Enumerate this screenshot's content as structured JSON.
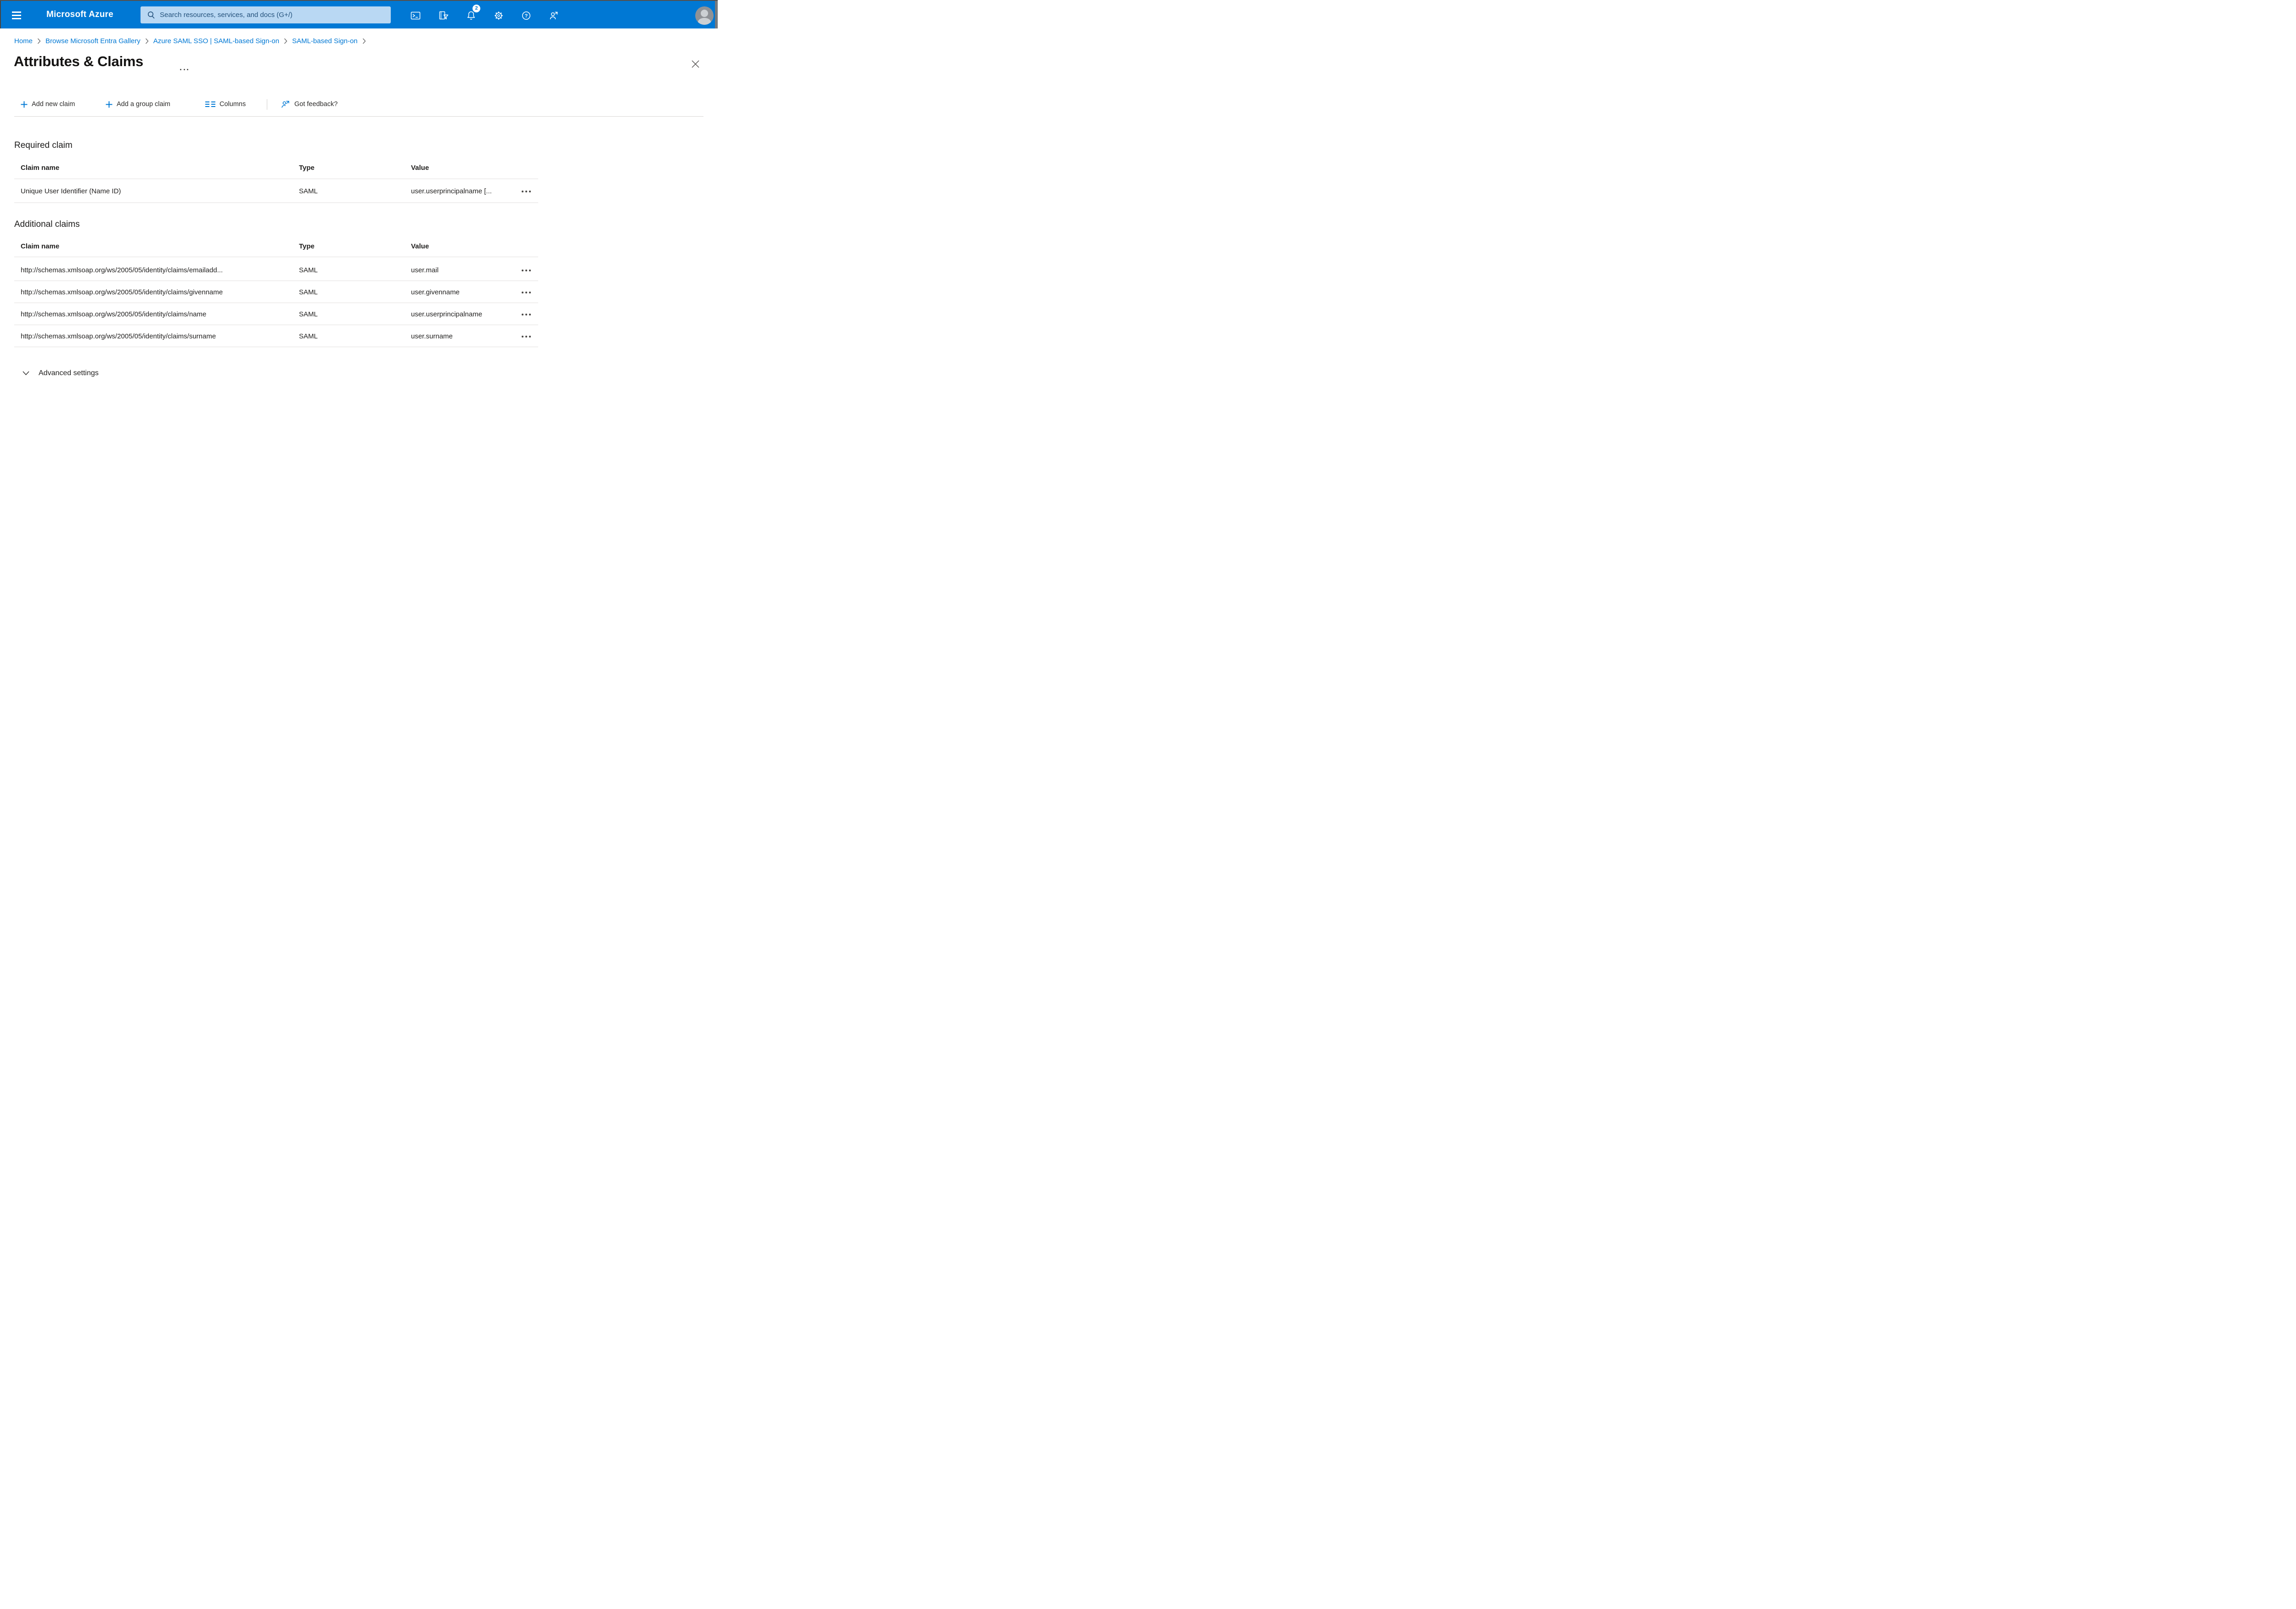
{
  "topbar": {
    "brand": "Microsoft Azure",
    "search_placeholder": "Search resources, services, and docs (G+/)",
    "notification_count": "2"
  },
  "breadcrumb": {
    "items": [
      "Home",
      "Browse Microsoft Entra Gallery",
      "Azure SAML SSO | SAML-based Sign-on",
      "SAML-based Sign-on"
    ]
  },
  "page": {
    "title": "Attributes & Claims"
  },
  "toolbar": {
    "add_new_claim": "Add new claim",
    "add_group_claim": "Add a group claim",
    "columns": "Columns",
    "got_feedback": "Got feedback?"
  },
  "table_columns": {
    "claim_name": "Claim name",
    "type": "Type",
    "value": "Value"
  },
  "required_claim": {
    "heading": "Required claim",
    "rows": [
      {
        "claim_name": "Unique User Identifier (Name ID)",
        "type": "SAML",
        "value": "user.userprincipalname [..."
      }
    ]
  },
  "additional_claims": {
    "heading": "Additional claims",
    "rows": [
      {
        "claim_name": "http://schemas.xmlsoap.org/ws/2005/05/identity/claims/emailadd...",
        "type": "SAML",
        "value": "user.mail"
      },
      {
        "claim_name": "http://schemas.xmlsoap.org/ws/2005/05/identity/claims/givenname",
        "type": "SAML",
        "value": "user.givenname"
      },
      {
        "claim_name": "http://schemas.xmlsoap.org/ws/2005/05/identity/claims/name",
        "type": "SAML",
        "value": "user.userprincipalname"
      },
      {
        "claim_name": "http://schemas.xmlsoap.org/ws/2005/05/identity/claims/surname",
        "type": "SAML",
        "value": "user.surname"
      }
    ]
  },
  "advanced_settings": {
    "label": "Advanced settings"
  },
  "icons": [
    "hamburger-menu",
    "search",
    "cloud-shell",
    "directories-filter",
    "notifications-bell",
    "settings-gear",
    "help",
    "feedback-person",
    "avatar",
    "more-options",
    "close",
    "add-plus",
    "columns",
    "got-feedback-person",
    "row-ellipsis",
    "chevron-down",
    "breadcrumb-chevron"
  ],
  "colors": {
    "topbar_blue": "#0078d4",
    "accent_blue": "#0078d4",
    "search_box_bg": "#b9d8f3",
    "search_text": "#24527c",
    "link_blue": "#0078d4",
    "text_dark": "#201f1e",
    "divider": "#e2e0de"
  }
}
